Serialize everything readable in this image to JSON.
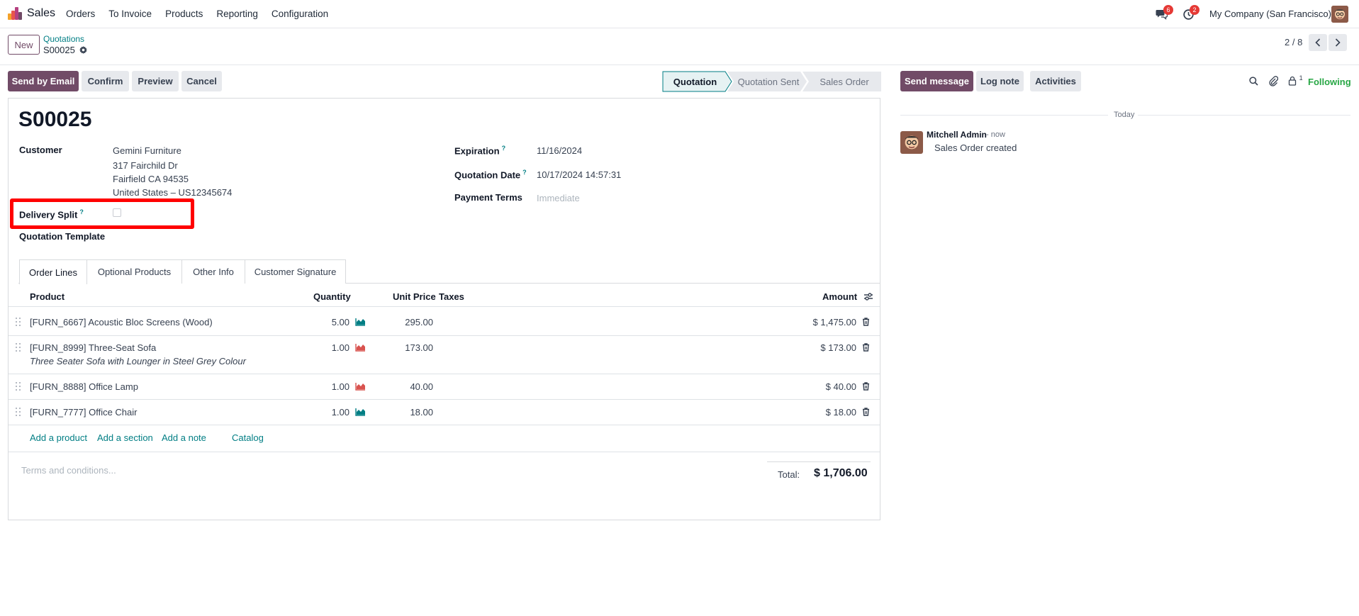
{
  "navbar": {
    "app": "Sales",
    "menu": [
      "Orders",
      "To Invoice",
      "Products",
      "Reporting",
      "Configuration"
    ],
    "messages_count": "6",
    "activities_count": "2",
    "company": "My Company (San Francisco)"
  },
  "control": {
    "new_label": "New",
    "breadcrumb_parent": "Quotations",
    "breadcrumb_current": "S00025",
    "pager": "2 / 8"
  },
  "actions": {
    "send_email": "Send by Email",
    "confirm": "Confirm",
    "preview": "Preview",
    "cancel": "Cancel"
  },
  "status": {
    "steps": [
      "Quotation",
      "Quotation Sent",
      "Sales Order"
    ],
    "active": "Quotation"
  },
  "form": {
    "name": "S00025",
    "customer_label": "Customer",
    "customer_lines": [
      "Gemini Furniture",
      "317 Fairchild Dr",
      "Fairfield CA 94535",
      "United States – US12345674"
    ],
    "delivery_split_label": "Delivery Split",
    "delivery_split_checked": false,
    "quotation_template_label": "Quotation Template",
    "expiration_label": "Expiration",
    "expiration_value": "11/16/2024",
    "quotation_date_label": "Quotation Date",
    "quotation_date_value": "10/17/2024 14:57:31",
    "payment_terms_label": "Payment Terms",
    "payment_terms_placeholder": "Immediate",
    "help_mark": "?"
  },
  "tabs": [
    "Order Lines",
    "Optional Products",
    "Other Info",
    "Customer Signature"
  ],
  "table": {
    "headers": {
      "product": "Product",
      "quantity": "Quantity",
      "unit_price": "Unit Price",
      "taxes": "Taxes",
      "amount": "Amount"
    },
    "rows": [
      {
        "product": "[FURN_6667] Acoustic Bloc Screens (Wood)",
        "description": "",
        "quantity": "5.00",
        "forecast": "ok",
        "unit_price": "295.00",
        "amount": "$ 1,475.00"
      },
      {
        "product": "[FURN_8999] Three-Seat Sofa",
        "description": "Three Seater Sofa with Lounger in Steel Grey Colour",
        "quantity": "1.00",
        "forecast": "warning",
        "unit_price": "173.00",
        "amount": "$ 173.00"
      },
      {
        "product": "[FURN_8888] Office Lamp",
        "description": "",
        "quantity": "1.00",
        "forecast": "warning",
        "unit_price": "40.00",
        "amount": "$ 40.00"
      },
      {
        "product": "[FURN_7777] Office Chair",
        "description": "",
        "quantity": "1.00",
        "forecast": "ok",
        "unit_price": "18.00",
        "amount": "$ 18.00"
      }
    ],
    "add_product": "Add a product",
    "add_section": "Add a section",
    "add_note": "Add a note",
    "catalog": "Catalog"
  },
  "footer": {
    "terms_placeholder": "Terms and conditions...",
    "total_label": "Total:",
    "total_value": "$ 1,706.00"
  },
  "chatter": {
    "send_message": "Send message",
    "log_note": "Log note",
    "activities": "Activities",
    "followers_count": "1",
    "following": "Following",
    "date_separator": "Today",
    "author": "Mitchell Admin",
    "time": "- now",
    "body": "Sales Order created"
  },
  "colors": {
    "primary": "#714b67",
    "link": "#017e84",
    "danger": "#e53935",
    "highlight": "#ff0000",
    "following": "#28a745"
  }
}
